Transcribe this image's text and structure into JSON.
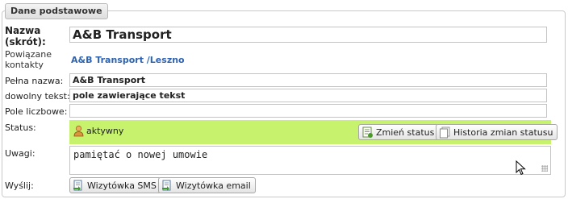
{
  "section": {
    "title": "Dane podstawowe"
  },
  "fields": {
    "nazwa": {
      "label_line1": "Nazwa",
      "label_line2": "(skrót):",
      "value": "A&B Transport"
    },
    "powiazane": {
      "label_line1": "Powiązane",
      "label_line2": "kontakty",
      "link": "A&B Transport /Leszno"
    },
    "pelna_nazwa": {
      "label": "Pełna nazwa:",
      "value": "A&B Transport"
    },
    "dowolny": {
      "label": "dowolny tekst:",
      "value": "pole zawierające tekst"
    },
    "liczbowe": {
      "label": "Pole liczbowe:",
      "value": ""
    },
    "status": {
      "label": "Status:",
      "value": "aktywny",
      "bg_color": "#c7f26d",
      "change_button": "Zmień status",
      "history_button": "Historia zmian statusu"
    },
    "uwagi": {
      "label": "Uwagi:",
      "value": "pamiętać o nowej umowie"
    },
    "wyslij": {
      "label": "Wyślij:",
      "sms_button": "Wizytówka SMS",
      "email_button": "Wizytówka email",
      "highlight_color": "#f5a86e"
    }
  },
  "colors": {
    "link": "#2d63b0",
    "border": "#c4c4c4"
  },
  "icons": [
    "person-icon",
    "refresh-status-icon",
    "history-icon",
    "sms-card-icon",
    "email-card-icon",
    "mouse-cursor-icon"
  ]
}
